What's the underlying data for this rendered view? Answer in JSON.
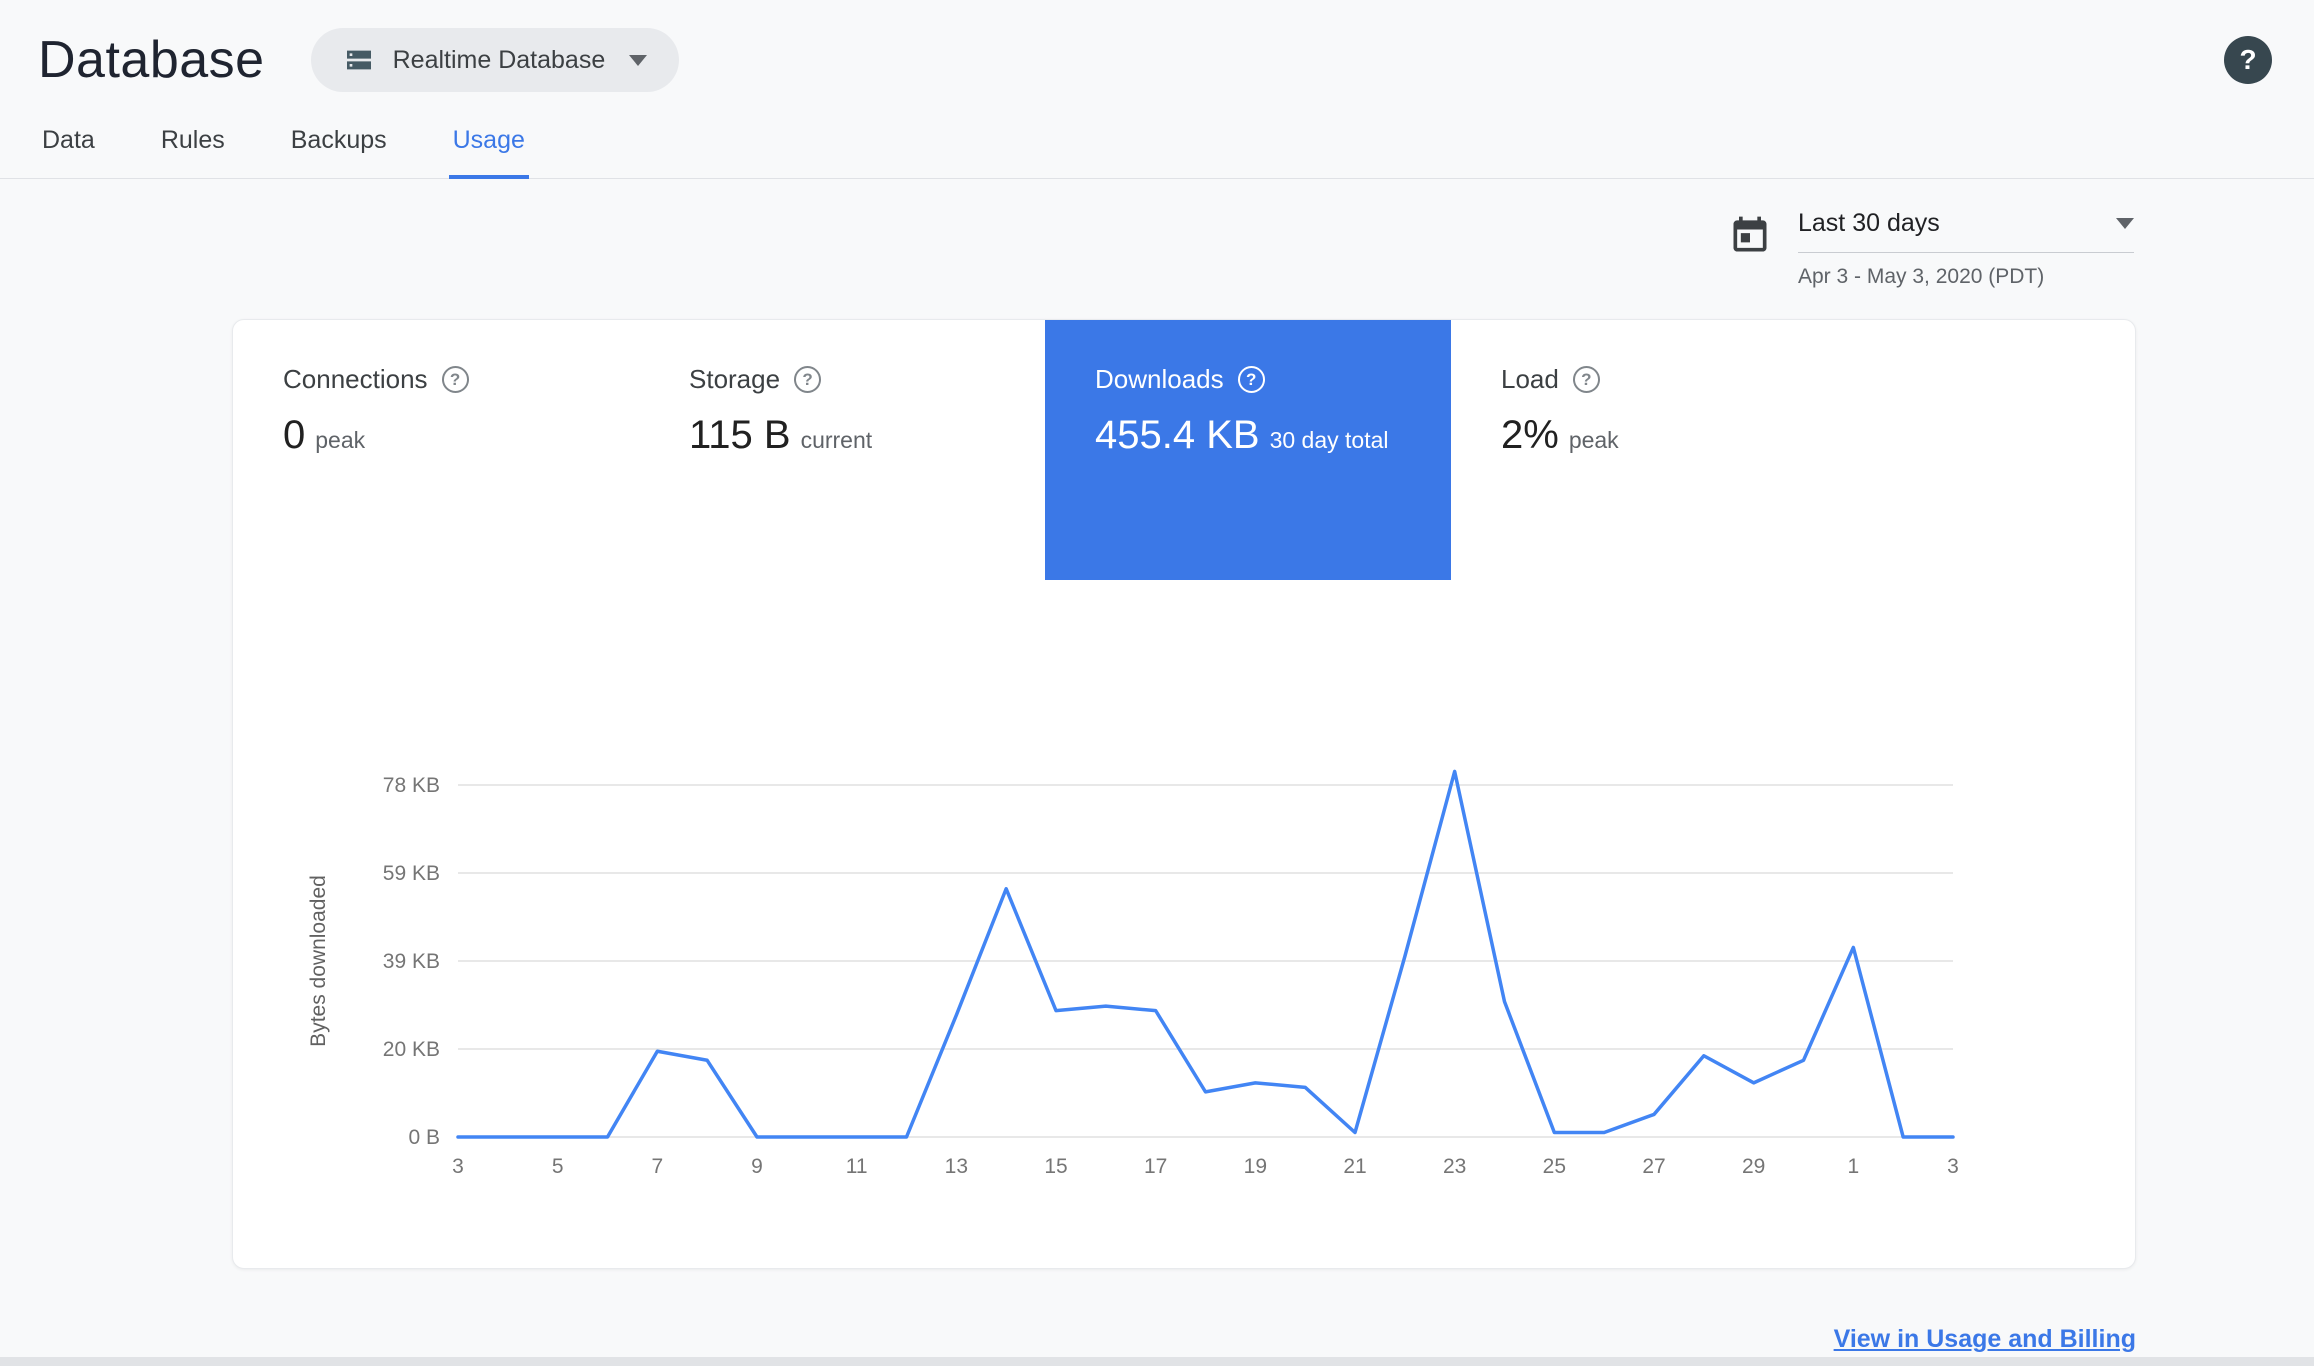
{
  "header": {
    "title": "Database",
    "database_selector": {
      "label": "Realtime Database"
    },
    "help_label": "?"
  },
  "tabs": [
    {
      "label": "Data",
      "active": false
    },
    {
      "label": "Rules",
      "active": false
    },
    {
      "label": "Backups",
      "active": false
    },
    {
      "label": "Usage",
      "active": true
    }
  ],
  "date_range": {
    "label": "Last 30 days",
    "detail": "Apr 3 - May 3, 2020 (PDT)"
  },
  "metrics": [
    {
      "label": "Connections",
      "value": "0",
      "unit": "peak",
      "selected": false
    },
    {
      "label": "Storage",
      "value": "115 B",
      "unit": "current",
      "selected": false
    },
    {
      "label": "Downloads",
      "value": "455.4 KB",
      "unit": "30 day total",
      "selected": true
    },
    {
      "label": "Load",
      "value": "2%",
      "unit": "peak",
      "selected": false
    }
  ],
  "chart_data": {
    "type": "line",
    "title": "Downloads (bytes downloaded per day)",
    "ylabel": "Bytes downloaded",
    "xlabel": "",
    "categories": [
      3,
      4,
      5,
      6,
      7,
      8,
      9,
      10,
      11,
      12,
      13,
      14,
      15,
      16,
      17,
      18,
      19,
      20,
      21,
      22,
      23,
      24,
      25,
      26,
      27,
      28,
      29,
      30,
      1,
      2,
      3
    ],
    "values_kb": [
      0,
      0,
      0,
      0,
      19,
      17,
      0,
      0,
      0,
      0,
      27,
      55,
      28,
      29,
      28,
      10,
      12,
      11,
      1,
      40,
      81,
      30,
      1,
      1,
      5,
      18,
      12,
      17,
      42,
      0,
      0
    ],
    "y_ticks": [
      {
        "label": "0 B",
        "value": 0
      },
      {
        "label": "20 KB",
        "value": 19.5
      },
      {
        "label": "39 KB",
        "value": 39
      },
      {
        "label": "59 KB",
        "value": 58.5
      },
      {
        "label": "78 KB",
        "value": 78
      }
    ],
    "x_tick_every": 2,
    "ylim": [
      0,
      78
    ],
    "grid": true,
    "legend": "none",
    "line_color": "#4285f4"
  },
  "footer": {
    "link_label": "View in Usage and Billing"
  },
  "colors": {
    "accent": "#3b78e7",
    "chart_line": "#4285f4",
    "selected_tile_bg": "#3b78e7",
    "page_bg": "#f8f9fa",
    "text_primary": "#212121",
    "text_secondary": "#5f6368"
  }
}
